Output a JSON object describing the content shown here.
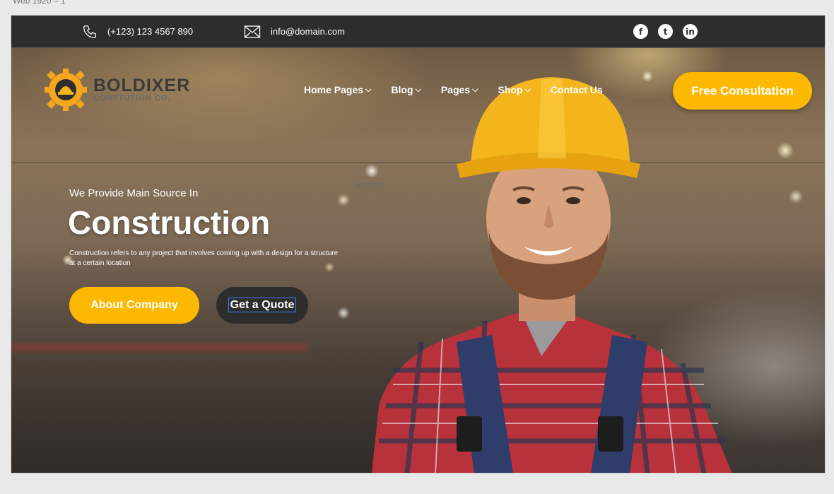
{
  "frame_label": "Web 1920 – 1",
  "topbar": {
    "phone": "(+123) 123 4567 890",
    "email": "info@domain.com",
    "socials": [
      {
        "name": "facebook-icon",
        "glyph": "f"
      },
      {
        "name": "twitter-icon",
        "glyph": "t"
      },
      {
        "name": "linkedin-icon",
        "glyph": "in"
      }
    ]
  },
  "brand": {
    "name": "BOLDIXER",
    "tagline": "CONSTUTION CO."
  },
  "nav": {
    "items": [
      {
        "label": "Home Pages",
        "has_dropdown": true
      },
      {
        "label": "Blog",
        "has_dropdown": true
      },
      {
        "label": "Pages",
        "has_dropdown": true
      },
      {
        "label": "Shop",
        "has_dropdown": true
      },
      {
        "label": "Contact Us",
        "has_dropdown": false
      }
    ],
    "cta_label": "Free Consultation"
  },
  "color_note": "#FDB900",
  "hero": {
    "subtitle": "We Provide Main Source In",
    "title": "Construction",
    "description": "Construction refers to any project that involves coming up with a design for a structure at a certain location",
    "primary_button": "About Company",
    "secondary_button": "Get a Quote"
  },
  "colors": {
    "accent": "#FDB900",
    "dark": "#2D2D2D",
    "white": "#FFFFFF"
  }
}
